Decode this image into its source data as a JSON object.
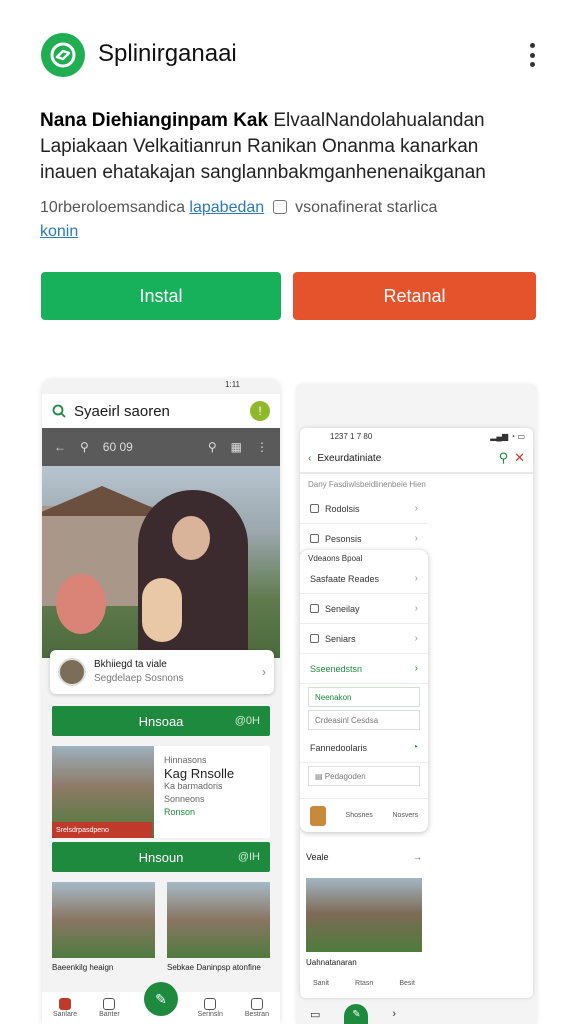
{
  "header": {
    "app_title": "Splinirganaai",
    "logo_icon": "app-logo-icon",
    "logo_color": "#1fae52"
  },
  "description": {
    "bold_lead": "Nana Diehianginpam Kak",
    "line1_rest": " ElvaalNandolahualandan",
    "line2": "Lapiakaan Velkaitianrun Ranikan Onanma kanarkan",
    "line3": "inauen ehatakajan sanglannbakmganhenenaikganan"
  },
  "meta": {
    "text1": "10rberoloemsandica ",
    "link1": "lapabedan",
    "text2": " vsonafinerat starlica",
    "link2": "konin"
  },
  "buttons": {
    "install": "Instal",
    "secondary": "Retanal",
    "install_color": "#16b15a",
    "secondary_color": "#e4532c"
  },
  "screen1": {
    "status": "1:11",
    "search_text": "Syaeirl saoren",
    "toolbar_num": "60 09",
    "card_title": "Bkhiiegd ta viale",
    "card_sub": "Segdelaep Sosnons",
    "bar1_label": "Hnsoaa",
    "bar1_right": "@0H",
    "feature_small": "Hinnasons",
    "feature_title": "Kag Rnsolle",
    "feature_line1": "Ka barmadoris",
    "feature_line2": "Sonneons",
    "feature_green": "Ronson",
    "feature_tag": "Srelsdrpasdpeno",
    "bar2_label": "Hnsoun",
    "bar2_right": "@IH",
    "tile1_caption": "Baeenkilg heaign",
    "tile2_caption": "Sebkae Daninpsp atonfine",
    "nav": [
      "Sanlare",
      "Banter",
      "Serinsln",
      "Bestran"
    ],
    "fab_icon": "pencil-icon"
  },
  "screen2": {
    "status_time": "1237 1 7 80",
    "header_title": "Exeurdatiniate",
    "sub_line": "Dany Fasdiwlsbeidlinenbeie Hien",
    "row1": "Rodolsis",
    "row2": "Pesonsis",
    "popup_header": "Vdeaons Bpoal",
    "popup_rows": [
      "Sasfaate Reades",
      "Seneilay",
      "Seniars"
    ],
    "popup_green": "Sseenedstsn",
    "input1": "Neenakon",
    "input2": "Crdeasinl Cesdsa",
    "row_status": "Fannedoolaris",
    "input3": "Pedagoden",
    "popup_nav": [
      "Shosnes",
      "Nosvers"
    ],
    "below_title": "Veale",
    "below_caption": "Uahnatanaran",
    "nav_bottom": [
      "Sanit",
      "Rtasn",
      "Besit"
    ]
  }
}
